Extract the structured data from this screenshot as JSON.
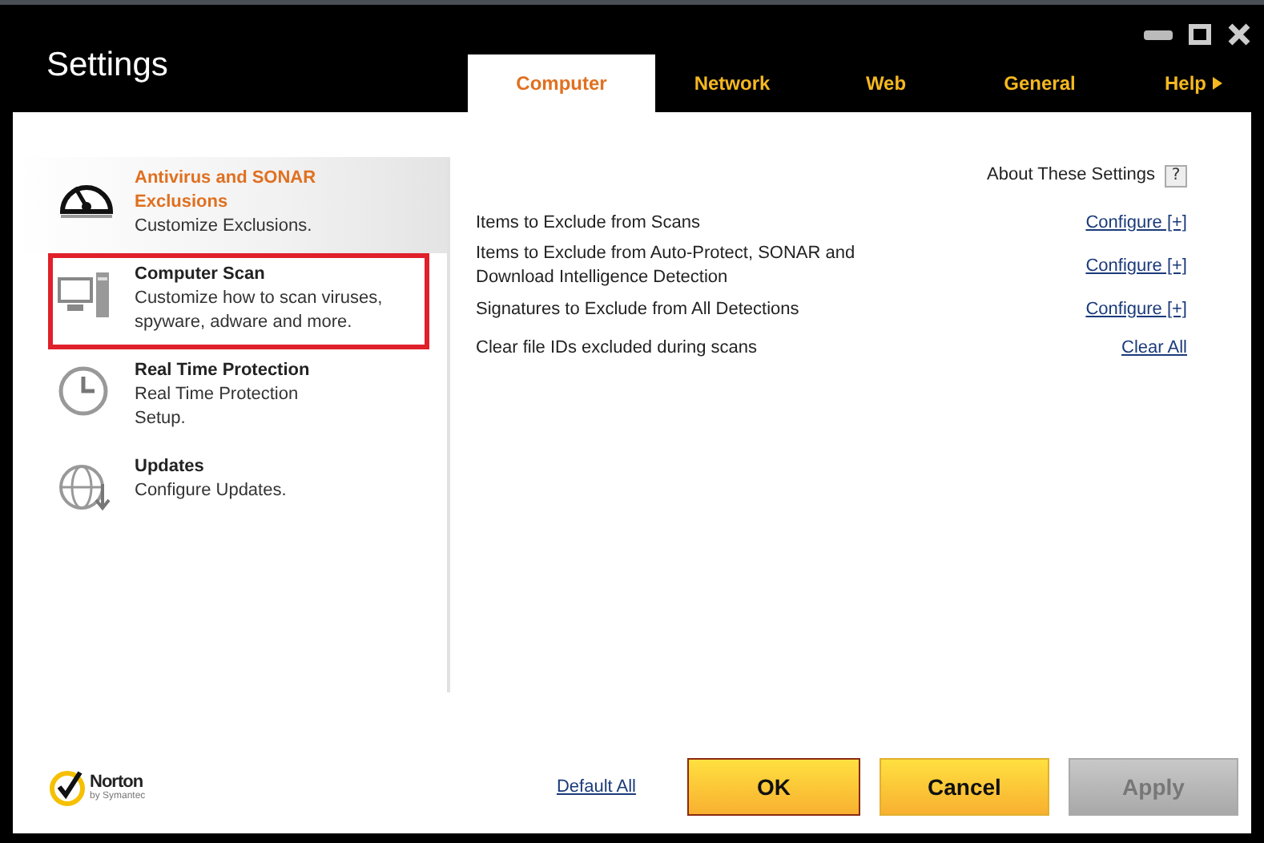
{
  "window": {
    "title": "Settings"
  },
  "tabs": [
    {
      "label": "Computer",
      "selected": true
    },
    {
      "label": "Network",
      "selected": false
    },
    {
      "label": "Web",
      "selected": false
    },
    {
      "label": "General",
      "selected": false
    },
    {
      "label": "Help",
      "selected": false,
      "kind": "menu"
    }
  ],
  "sidebar": {
    "items": [
      {
        "title": "Antivirus and SONAR Exclusions",
        "subtitle": "Customize Exclusions.",
        "kind": "gauge",
        "selected": true,
        "outlined": false
      },
      {
        "title": "Computer Scan",
        "subtitle": "Customize how to scan viruses, spyware, adware and more.",
        "kind": "computer",
        "selected": false,
        "outlined": true
      },
      {
        "title": "Real Time Protection",
        "subtitle": "Real Time Protection Setup.",
        "kind": "clock",
        "selected": false,
        "outlined": false
      },
      {
        "title": "Updates",
        "subtitle": "Configure Updates.",
        "kind": "globe",
        "selected": false,
        "outlined": false
      }
    ]
  },
  "about": {
    "label": "About These Settings",
    "help": "?"
  },
  "settings": [
    {
      "label": "Items to Exclude from Scans",
      "action": "Configure [+]"
    },
    {
      "label": "Items to Exclude from Auto-Protect, SONAR and Download Intelligence Detection",
      "action": "Configure [+]"
    },
    {
      "label": "Signatures to Exclude from All Detections",
      "action": "Configure [+]"
    },
    {
      "label": "Clear file IDs excluded during scans",
      "action": "Clear All"
    }
  ],
  "footer": {
    "brand": "Norton",
    "brand_sub": "by Symantec",
    "default_all": "Default All",
    "buttons": [
      {
        "label": "OK",
        "kind": "primary",
        "disabled": false
      },
      {
        "label": "Cancel",
        "kind": "normal",
        "disabled": false
      },
      {
        "label": "Apply",
        "kind": "normal",
        "disabled": true
      }
    ]
  }
}
